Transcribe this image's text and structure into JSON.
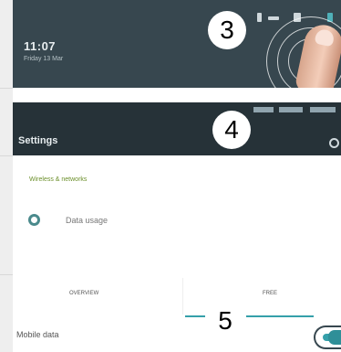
{
  "notification": {
    "time": "11:07",
    "date": "Friday 13 Mar",
    "step_number": "3"
  },
  "settings": {
    "title": "Settings",
    "step_number": "4",
    "section_header": "Wireless & networks",
    "data_usage_label": "Data usage"
  },
  "data_usage": {
    "tab_overview": "OVERVIEW",
    "tab_free": "FREE",
    "step_number": "5",
    "mobile_data_label": "Mobile data",
    "mobile_data_on": true
  },
  "colors": {
    "shade_bg": "#37474f",
    "settings_bar": "#263238",
    "accent_teal": "#35a0aa",
    "section_green": "#6b8f2a"
  }
}
